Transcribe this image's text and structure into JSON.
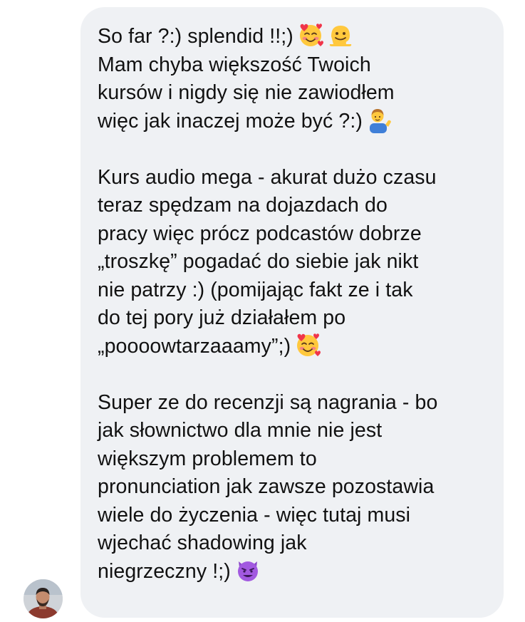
{
  "message": {
    "lines": [
      {
        "text": "So far ?:) splendid !!;)",
        "emojis": [
          "smiling-face-with-hearts-icon",
          "melting-face-icon"
        ]
      },
      {
        "text": "Mam chyba większość Twoich",
        "emojis": []
      },
      {
        "text": "kursów i nigdy się nie zawiodłem",
        "emojis": []
      },
      {
        "text": "więc jak inaczej może być ?:)",
        "emojis": [
          "man-tipping-hand-icon"
        ]
      },
      {
        "text": "",
        "emojis": []
      },
      {
        "text": "Kurs audio mega - akurat dużo czasu",
        "emojis": []
      },
      {
        "text": "teraz spędzam na dojazdach do",
        "emojis": []
      },
      {
        "text": "pracy więc prócz podcastów dobrze",
        "emojis": []
      },
      {
        "text": "„troszkę” pogadać do siebie jak nikt",
        "emojis": []
      },
      {
        "text": "nie patrzy :) (pomijając fakt ze i tak",
        "emojis": []
      },
      {
        "text": "do tej pory już działałem po",
        "emojis": []
      },
      {
        "text": "„poooowtarzaaamy”;)",
        "emojis": [
          "smiling-face-with-hearts-icon"
        ]
      },
      {
        "text": "",
        "emojis": []
      },
      {
        "text": "Super ze do recenzji są nagrania - bo",
        "emojis": []
      },
      {
        "text": "jak słownictwo dla mnie nie jest",
        "emojis": []
      },
      {
        "text": "większym problemem to",
        "emojis": []
      },
      {
        "text": "pronunciation jak zawsze pozostawia",
        "emojis": []
      },
      {
        "text": "wiele do życzenia - więc tutaj musi",
        "emojis": []
      },
      {
        "text": "wjechać shadowing jak",
        "emojis": []
      },
      {
        "text": "niegrzeczny !;)",
        "emojis": [
          "smiling-face-with-horns-icon"
        ]
      }
    ]
  },
  "sender": {
    "avatar_icon": "user-avatar-photo"
  },
  "colors": {
    "bubble_background": "#eff1f4",
    "text": "#111111",
    "page_background": "#ffffff"
  }
}
